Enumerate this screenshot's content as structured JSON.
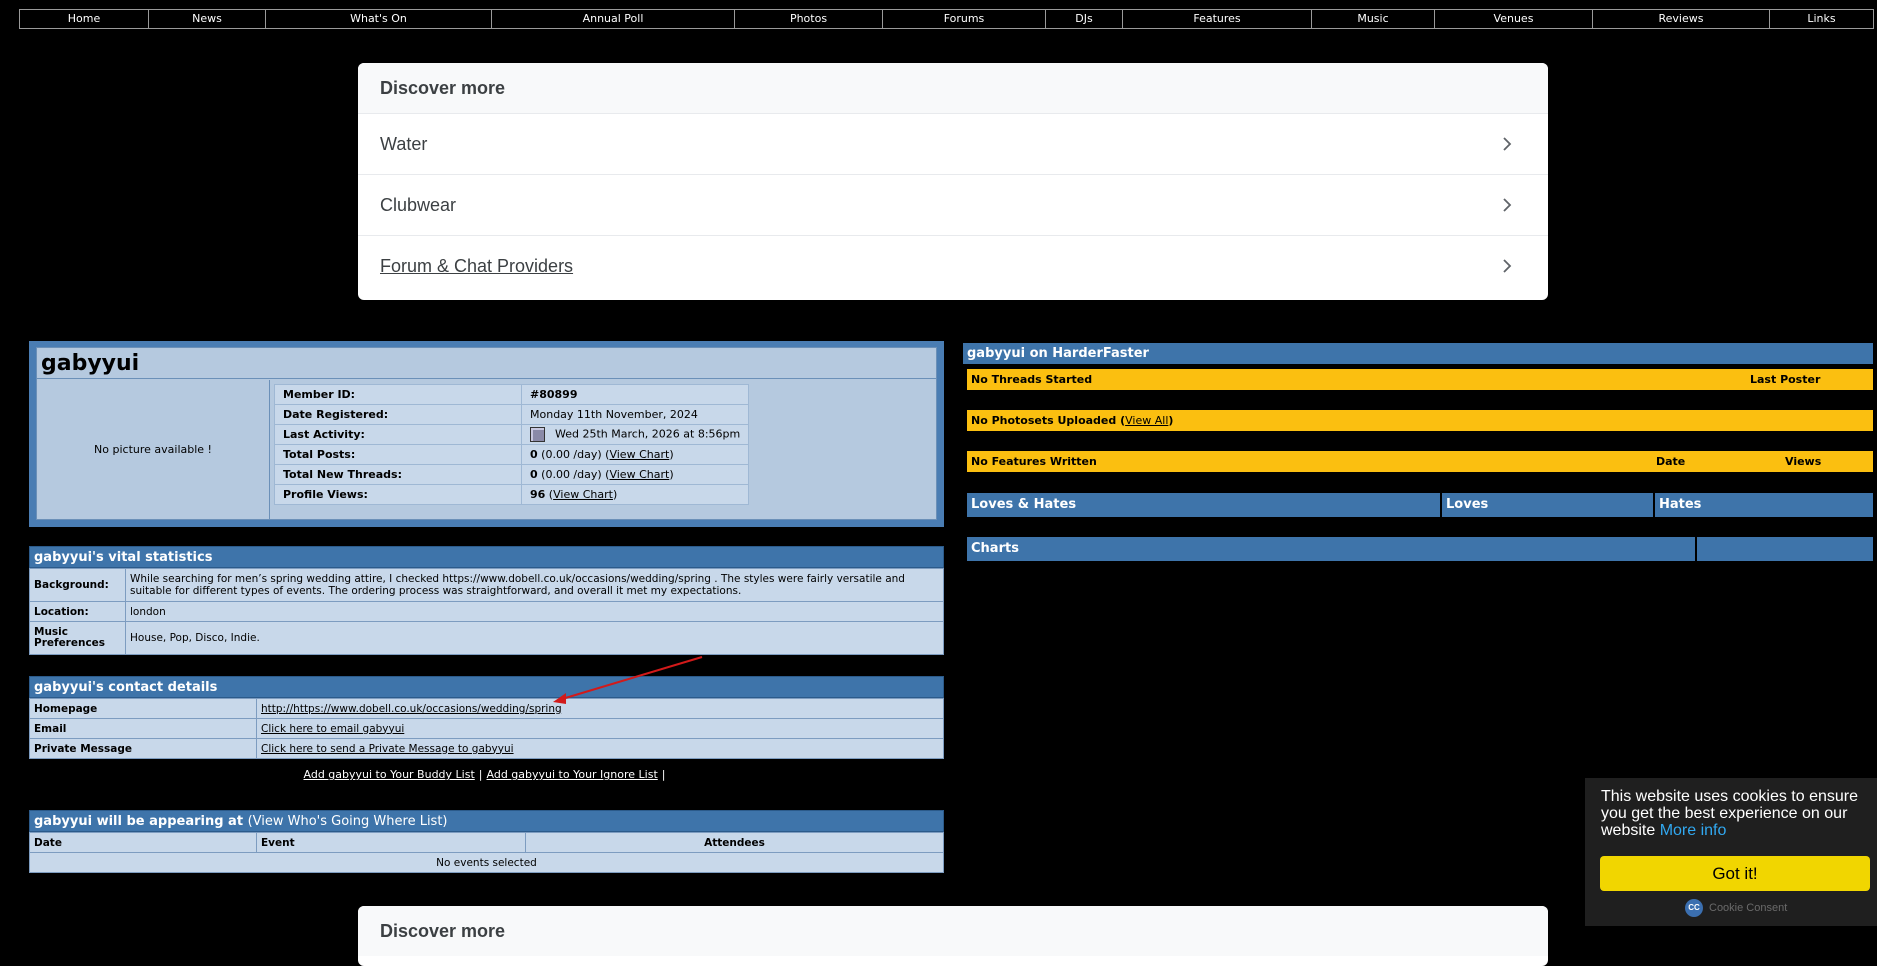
{
  "nav": [
    "Home",
    "News",
    "What's On",
    "Annual Poll",
    "Photos",
    "Forums",
    "DJs",
    "Features",
    "Music",
    "Venues",
    "Reviews",
    "Links"
  ],
  "discover_top": {
    "title": "Discover more",
    "items": [
      "Water",
      "Clubwear",
      "Forum & Chat Providers"
    ]
  },
  "discover_bottom": {
    "title": "Discover more"
  },
  "profile": {
    "username": "gabyyui",
    "no_picture": "No picture available !",
    "rows": [
      {
        "label": "Member ID:",
        "value": "#80899"
      },
      {
        "label": "Date Registered:",
        "value": "Monday 11th November, 2024"
      },
      {
        "label": "Last Activity:",
        "value": "Wed 25th March, 2026 at 8:56pm"
      },
      {
        "label": "Total Posts:",
        "count": "0",
        "rate": "(0.00 /day)",
        "link": "View Chart"
      },
      {
        "label": "Total New Threads:",
        "count": "0",
        "rate": "(0.00 /day)",
        "link": "View Chart"
      },
      {
        "label": "Profile Views:",
        "count": "96",
        "link": "View Chart"
      }
    ]
  },
  "vitals": {
    "title": "gabyyui's vital statistics",
    "background_label": "Background:",
    "background": "While searching for men’s spring wedding attire, I checked https://www.dobell.co.uk/occasions/wedding/spring . The styles were fairly versatile and suitable for different types of events. The ordering process was straightforward, and overall it met my expectations.",
    "location_label": "Location:",
    "location": "london",
    "music_label": "Music Preferences",
    "music": "House, Pop, Disco, Indie."
  },
  "contact": {
    "title": "gabyyui's contact details",
    "homepage_label": "Homepage",
    "homepage": "http://https://www.dobell.co.uk/occasions/wedding/spring",
    "email_label": "Email",
    "email": "Click here to email gabyyui",
    "pm_label": "Private Message",
    "pm": "Click here to send a Private Message to gabyyui"
  },
  "buddy": {
    "add_buddy": "Add gabyyui to Your Buddy List",
    "add_ignore": "Add gabyyui to Your Ignore List"
  },
  "events": {
    "title": "gabyyui will be appearing at",
    "sub": "(View Who's Going Where List)",
    "col_date": "Date",
    "col_event": "Event",
    "col_attendees": "Attendees",
    "empty": "No events selected"
  },
  "right": {
    "title": "gabyyui on HarderFaster",
    "threads": "No Threads Started",
    "threads_col": "Last Poster",
    "photos": "No Photosets Uploaded",
    "photos_link": "View All",
    "features": "No Features Written",
    "features_date": "Date",
    "features_views": "Views",
    "loves_hates": "Loves & Hates",
    "loves": "Loves",
    "hates": "Hates",
    "charts": "Charts"
  },
  "cookie": {
    "message": "This website uses cookies to ensure you get the best experience on our website",
    "more": "More info",
    "button": "Got it!",
    "brand": "Cookie Consent"
  }
}
